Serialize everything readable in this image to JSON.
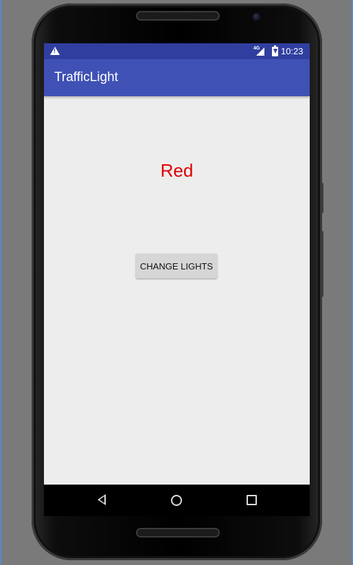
{
  "status_bar": {
    "warning_icon": "warning-icon",
    "network_label": "4G",
    "signal_icon": "signal-icon",
    "battery_icon": "battery-charging-icon",
    "time": "10:23",
    "color": "#303f9f"
  },
  "app_bar": {
    "title": "TrafficLight",
    "color": "#3f51b5"
  },
  "content": {
    "light_label": "Red",
    "light_color": "#e00000",
    "button_label": "CHANGE LIGHTS"
  },
  "nav_bar": {
    "back_icon": "back-icon",
    "home_icon": "home-icon",
    "recents_icon": "recents-icon"
  }
}
